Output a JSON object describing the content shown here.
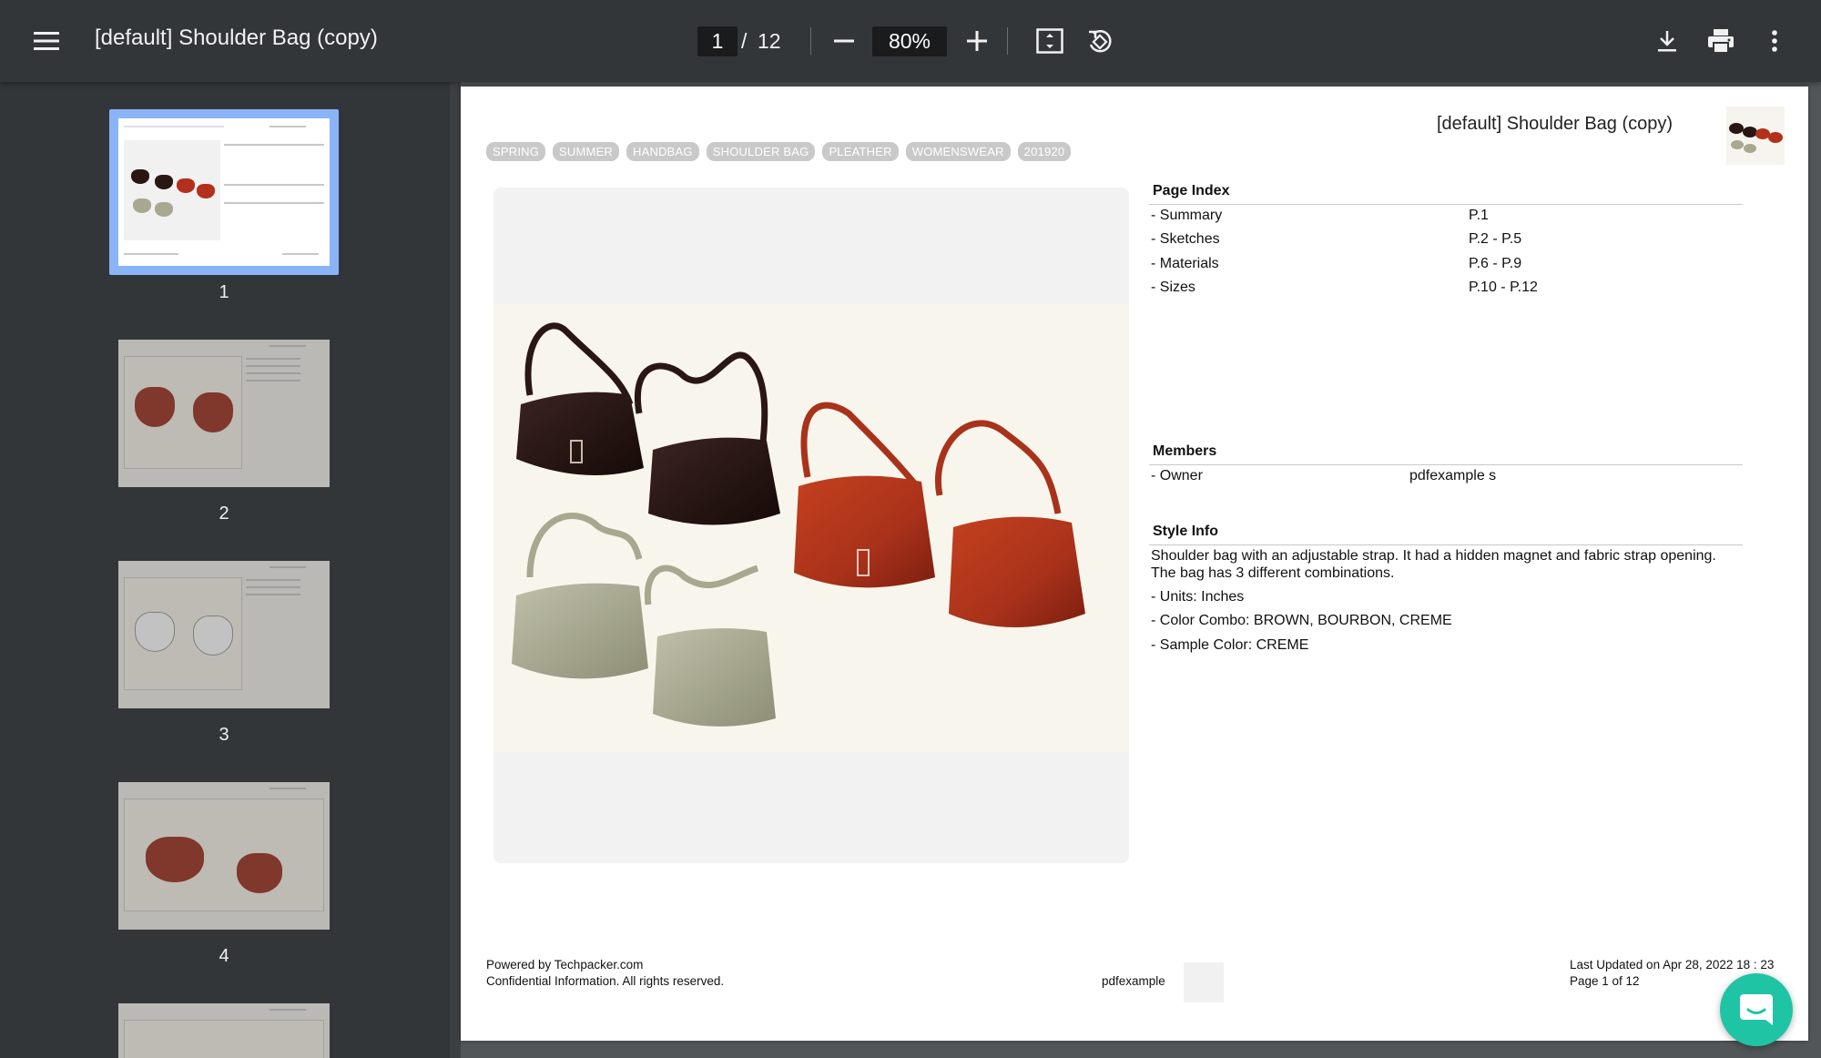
{
  "toolbar": {
    "title": "[default] Shoulder Bag (copy)",
    "page_current": "1",
    "page_sep": "/",
    "page_total": "12",
    "zoom": "80%",
    "icons": [
      "menu-icon",
      "zoom-out-icon",
      "zoom-in-icon",
      "fit-page-icon",
      "rotate-icon",
      "download-icon",
      "print-icon",
      "more-options-icon"
    ]
  },
  "sidebar": {
    "thumbnails": [
      {
        "label": "1",
        "selected": true
      },
      {
        "label": "2",
        "selected": false
      },
      {
        "label": "3",
        "selected": false
      },
      {
        "label": "4",
        "selected": false
      }
    ]
  },
  "page": {
    "tags": [
      "SPRING",
      "SUMMER",
      "HANDBAG",
      "SHOULDER BAG",
      "PLEATHER",
      "WOMENSWEAR",
      "201920"
    ],
    "header_title": "[default] Shoulder Bag (copy)",
    "page_index": {
      "title": "Page Index",
      "rows": [
        {
          "label": "- Summary",
          "value": "P.1"
        },
        {
          "label": "- Sketches",
          "value": "P.2 - P.5"
        },
        {
          "label": "- Materials",
          "value": "P.6 - P.9"
        },
        {
          "label": "- Sizes",
          "value": "P.10 - P.12"
        }
      ]
    },
    "members": {
      "title": "Members",
      "rows": [
        {
          "label": "- Owner",
          "value": "pdfexample s"
        }
      ]
    },
    "style_info": {
      "title": "Style Info",
      "description_line1": "Shoulder bag with an adjustable strap. It had a hidden magnet and fabric strap opening.",
      "description_line2": "The bag has 3 different combinations.",
      "units": "- Units: Inches",
      "color_combo": "- Color Combo: BROWN, BOURBON, CREME",
      "sample_color": "- Sample Color: CREME"
    },
    "footer": {
      "powered_by": "Powered by Techpacker.com",
      "confidential": "Confidential Information. All rights reserved.",
      "company": "pdfexample",
      "last_updated": "Last Updated on Apr 28, 2022 18 : 23",
      "page_of": "Page 1 of 12"
    },
    "colors": {
      "brown": "#2a1714",
      "bourbon": "#b3301c",
      "creme": "#a7a88f"
    }
  },
  "chat": {
    "icon": "chat-icon"
  }
}
